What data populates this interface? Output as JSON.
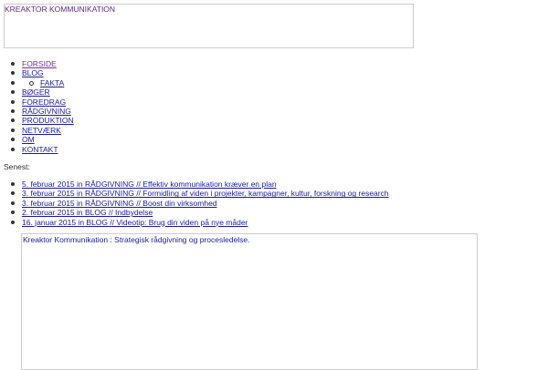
{
  "header": {
    "site_title": "KREAKTOR KOMMUNIKATION"
  },
  "nav": {
    "items": [
      {
        "label": "FORSIDE"
      },
      {
        "label": "BLOG"
      },
      {
        "label": "FAKTA"
      },
      {
        "label": "BØGER"
      },
      {
        "label": "FOREDRAG"
      },
      {
        "label": "RÅDGIVNING"
      },
      {
        "label": "PRODUKTION"
      },
      {
        "label": "NETVÆRK"
      },
      {
        "label": "OM"
      },
      {
        "label": "KONTAKT"
      }
    ]
  },
  "recent": {
    "label": "Senest:",
    "items": [
      {
        "text": "5. februar 2015 in RÅDGIVNING // Effektiv kommunikation kræver en plan"
      },
      {
        "text": "3. februar 2015 in RÅDGIVNING // Formidling af viden i projekter, kampagner, kultur, forskning og research"
      },
      {
        "text": "3. februar 2015 in RÅDGIVNING // Boost din virksomhed"
      },
      {
        "text": "2. februar 2015 in BLOG // Indbydelse"
      },
      {
        "text": "16. januar 2015 in BLOG // Videotip: Brug din viden på nye måder"
      }
    ]
  },
  "content": {
    "tagline": "Kreaktor Kommunikation : Strategisk rådgivning og procesledelse."
  },
  "colors": {
    "link": "#1a1aa6",
    "active_link": "#7a2fa0",
    "title": "#5b2a86",
    "border": "#cccccc"
  }
}
